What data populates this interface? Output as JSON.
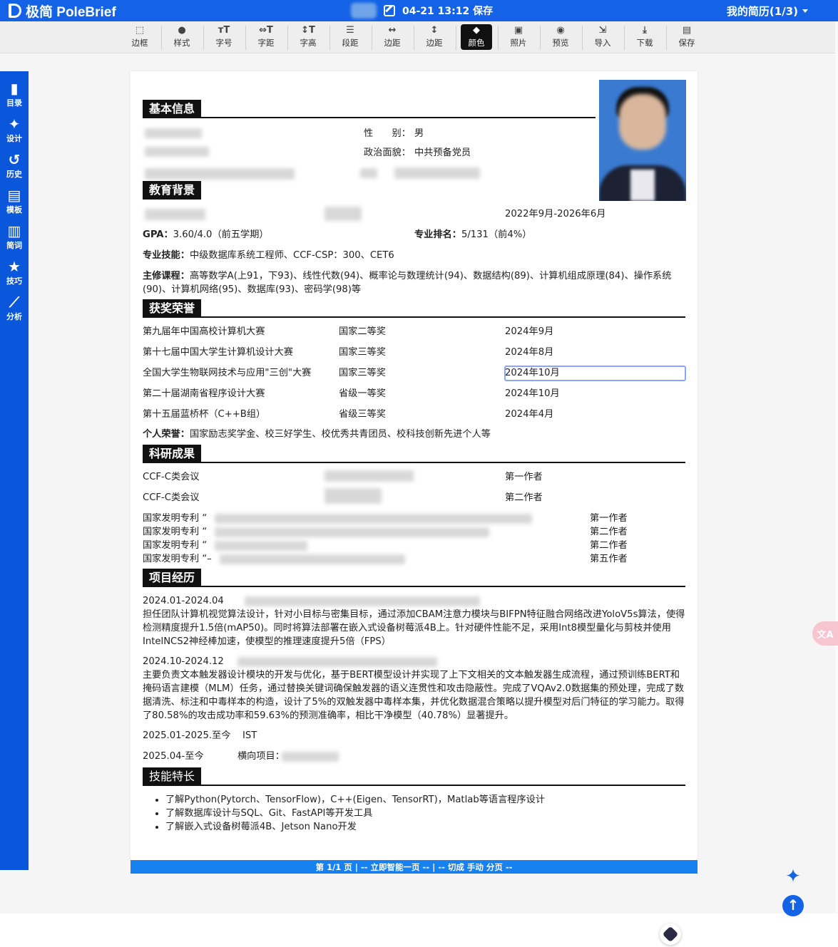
{
  "app": {
    "name": "极简 PoleBrief",
    "save_status": "04-21 13:12 保存",
    "my_resume": "我的简历(1/3)"
  },
  "toolbar": [
    {
      "icon": "border-icon",
      "glyph": "⬚",
      "label": "边框"
    },
    {
      "icon": "style-icon",
      "glyph": "●",
      "label": "样式"
    },
    {
      "icon": "font-size-icon",
      "glyph": "тT",
      "label": "字号"
    },
    {
      "icon": "letter-spacing-icon",
      "glyph": "⇔T",
      "label": "字距"
    },
    {
      "icon": "line-height-icon",
      "glyph": "↕T",
      "label": "字高"
    },
    {
      "icon": "paragraph-spacing-icon",
      "glyph": "☰",
      "label": "段距"
    },
    {
      "icon": "horizontal-margin-icon",
      "glyph": "↔",
      "label": "边距"
    },
    {
      "icon": "vertical-margin-icon",
      "glyph": "↕",
      "label": "边距"
    },
    {
      "icon": "color-fill-icon",
      "glyph": "◆",
      "label": "颜色"
    },
    {
      "icon": "photo-icon",
      "glyph": "▣",
      "label": "照片"
    },
    {
      "icon": "preview-eye-icon",
      "glyph": "◉",
      "label": "预览"
    },
    {
      "icon": "import-icon",
      "glyph": "⇲",
      "label": "导入"
    },
    {
      "icon": "download-icon",
      "glyph": "⤓",
      "label": "下载"
    },
    {
      "icon": "save-disk-icon",
      "glyph": "▤",
      "label": "保存"
    }
  ],
  "sidebar": [
    {
      "icon": "bookmark-icon",
      "glyph": "▮",
      "label": "目录"
    },
    {
      "icon": "magic-wand-icon",
      "glyph": "✦",
      "label": "设计"
    },
    {
      "icon": "history-icon",
      "glyph": "↺",
      "label": "历史"
    },
    {
      "icon": "template-file-icon",
      "glyph": "▤",
      "label": "模板"
    },
    {
      "icon": "book-icon",
      "glyph": "▥",
      "label": "简词"
    },
    {
      "icon": "star-icon",
      "glyph": "★",
      "label": "技巧"
    },
    {
      "icon": "chart-icon",
      "glyph": "⟋",
      "label": "分析"
    }
  ],
  "resume": {
    "sections": {
      "basic": "基本信息",
      "education": "教育背景",
      "awards": "获奖荣誉",
      "research": "科研成果",
      "projects": "项目经历",
      "skills": "技能特长"
    },
    "basic": {
      "gender_label": "性　　别：",
      "gender": "男",
      "political_label": "政治面貌：",
      "political": "中共预备党员"
    },
    "education": {
      "period": "2022年9月-2026年6月",
      "gpa_label": "GPA：",
      "gpa": "3.60/4.0（前五学期）",
      "rank_label": "专业排名：",
      "rank": "5/131（前4%）",
      "skills_label": "专业技能：",
      "skills": "中级数据库系统工程师、CCF-CSP：300、CET6",
      "courses_label": "主修课程：",
      "courses": "高等数学A(上91，下93)、线性代数(94)、概率论与数理统计(94)、数据结构(89)、计算机组成原理(84)、操作系统(90)、计算机网络(95)、数据库(93)、密码学(98)等"
    },
    "awards": [
      {
        "name": "第九届年中国高校计算机大赛",
        "level": "国家二等奖",
        "date": "2024年9月"
      },
      {
        "name": "第十七届中国大学生计算机设计大赛",
        "level": "国家三等奖",
        "date": "2024年8月"
      },
      {
        "name": "全国大学生物联网技术与应用\"三创\"大赛",
        "level": "国家三等奖",
        "date": "2024年10月"
      },
      {
        "name": "第二十届湖南省程序设计大赛",
        "level": "省级一等奖",
        "date": "2024年10月"
      },
      {
        "name": "第十五届蓝桥杯（C++B组）",
        "level": "省级三等奖",
        "date": "2024年4月"
      }
    ],
    "honors_label": "个人荣誉：",
    "honors": "国家励志奖学金、校三好学生、校优秀共青团员、校科技创新先进个人等",
    "research": [
      {
        "type": "CCF-C类会议",
        "role": "第一作者"
      },
      {
        "type": "CCF-C类会议",
        "role": "第二作者"
      }
    ],
    "patents": [
      {
        "type": "国家发明专利",
        "mark": "“",
        "role": "第一作者"
      },
      {
        "type": "国家发明专利",
        "mark": "“",
        "role": "第二作者"
      },
      {
        "type": "国家发明专利",
        "mark": "“",
        "role": "第二作者"
      },
      {
        "type": "国家发明专利",
        "mark": "“–",
        "role": "第五作者"
      }
    ],
    "projects": [
      {
        "period": "2024.01-2024.04",
        "desc": "担任团队计算机视觉算法设计，针对小目标与密集目标，通过添加CBAM注意力模块与BIFPN特征融合网络改进YoloV5s算法，使得检测精度提升1.5倍(mAP50)。同时将算法部署在嵌入式设备树莓派4B上。针对硬件性能不足，采用Int8模型量化与剪枝并使用IntelNCS2神经棒加速，使模型的推理速度提升5倍（FPS）"
      },
      {
        "period": "2024.10-2024.12",
        "desc": "主要负责文本触发器设计模块的开发与优化，基于BERT模型设计并实现了上下文相关的文本触发器生成流程，通过预训练BERT和掩码语言建模（MLM）任务，通过替换关键词确保触发器的语义连贯性和攻击隐蔽性。完成了VQAv2.0数据集的预处理，完成了数据清洗、标注和中毒样本的构造，设计了5%的双触发器中毒样本集，并优化数据混合策略以提升模型对后门特征的学习能力。取得了80.58%的攻击成功率和59.63%的预测准确率，相比干净模型（40.78%）显著提升。"
      },
      {
        "period": "2025.01-2025.至今",
        "title": "IST",
        "desc": ""
      },
      {
        "period": "2025.04-至今",
        "title": "横向项目：",
        "desc": ""
      }
    ],
    "skills": [
      "了解Python(Pytorch、TensorFlow)，C++(Eigen、TensorRT)，Matlab等语言程序设计",
      "了解数据库设计与SQL、Git、FastAPI等开发工具",
      "了解嵌入式设备树莓派4B、Jetson Nano开发"
    ]
  },
  "pager": {
    "page": "第 1/1 页",
    "smart": "| -- 立即智能一页 -- |",
    "manual": "-- 切成 手动 分页 --"
  },
  "float": {
    "translate": "文A",
    "up": "↑"
  }
}
